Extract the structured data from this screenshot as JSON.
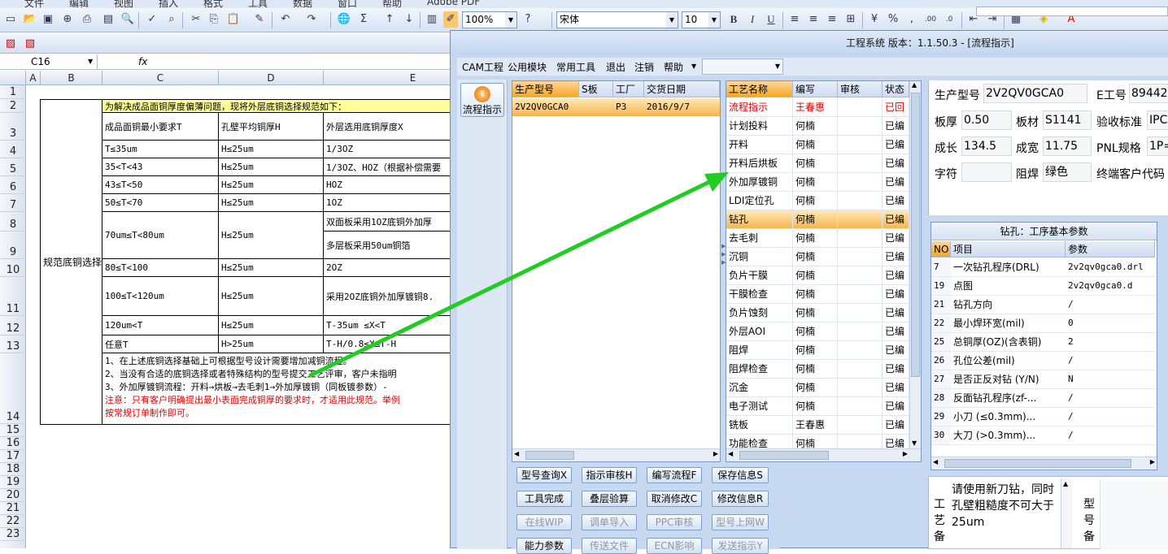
{
  "excel": {
    "menu_fragments": [
      "文件",
      "编辑",
      "视图",
      "插入",
      "格式",
      "工具",
      "数据",
      "窗口",
      "帮助",
      "Adobe PDF"
    ],
    "zoom": "100%",
    "font_name": "宋体",
    "font_size": "10",
    "bold": "B",
    "italic": "I",
    "underline": "U",
    "name_box": "C16",
    "fx": "fx",
    "columns": [
      "A",
      "B",
      "C",
      "D",
      "E"
    ],
    "rows": [
      "1",
      "2",
      "3",
      "4",
      "5",
      "6",
      "7",
      "8",
      "9",
      "10",
      "11",
      "12",
      "13",
      "14",
      "15",
      "16",
      "17",
      "18",
      "19",
      "20",
      "21",
      "22",
      "23"
    ],
    "merged_label": "规范底铜选择",
    "banner": "为解决成品面铜厚度偏薄问题，现将外层底铜选择规范如下：",
    "header_row": [
      "成品面铜最小要求T",
      "孔壁平均铜厚H",
      "外层选用底铜厚度X"
    ],
    "table_rows": [
      [
        "T≤35um",
        "H≤25um",
        "1/3OZ"
      ],
      [
        "35<T<43",
        "H≤25um",
        "1/3OZ、HOZ（根据补偿需要"
      ],
      [
        "43≤T<50",
        "H≤25um",
        "HOZ"
      ],
      [
        "50≤T<70",
        "H≤25um",
        "1OZ"
      ],
      [
        "70um≤T<80um",
        "H≤25um",
        "双面板采用1OZ底铜外加厚"
      ],
      [
        "",
        "",
        "多层板采用50um铜箔"
      ],
      [
        "80≤T<100",
        "H≤25um",
        "2OZ"
      ],
      [
        "100≤T<120um",
        "H≤25um",
        "采用2OZ底铜外加厚镀铜8."
      ],
      [
        "120um<T",
        "H≤25um",
        "T-35um ≤X<T"
      ],
      [
        "任意T",
        "H>25um",
        "T-H/0.8≤X≤T-H"
      ]
    ],
    "notes": [
      "1、在上述底铜选择基础上可根据型号设计需要增加减铜流程。",
      "2、当没有合适的底铜选择或者特殊结构的型号提交工艺评审，客户未指明",
      "3、外加厚镀铜流程：开料→烘板→去毛刺1→外加厚镀铜（同板镀参数）-",
      "注意：只有客户明确提出最小表面完成铜厚的要求时，才适用此规范。举例",
      "按常规订单制作即可。"
    ]
  },
  "window": {
    "title": "工程系统  版本：1.1.50.3 - [流程指示]",
    "menu": [
      "CAM工程",
      "公用模块",
      "常用工具",
      "退出",
      "注销",
      "帮助"
    ],
    "flow_button": "流程指示",
    "orders": {
      "headers": [
        "生产型号",
        "S板",
        "工厂",
        "交货日期"
      ],
      "rows": [
        [
          "2V2QV0GCA0",
          "",
          "P3",
          "2016/9/7"
        ]
      ]
    },
    "processes": {
      "headers": [
        "工艺名称",
        "编写",
        "审核",
        "状态"
      ],
      "rows": [
        [
          "流程指示",
          "王春惠",
          "",
          "已回"
        ],
        [
          "计划投料",
          "何楠",
          "",
          "已编"
        ],
        [
          "开料",
          "何楠",
          "",
          "已编"
        ],
        [
          "开料后烘板",
          "何楠",
          "",
          "已编"
        ],
        [
          "外加厚镀铜",
          "何楠",
          "",
          "已编"
        ],
        [
          "LDI定位孔",
          "何楠",
          "",
          "已编"
        ],
        [
          "钻孔",
          "何楠",
          "",
          "已编"
        ],
        [
          "去毛刺",
          "何楠",
          "",
          "已编"
        ],
        [
          "沉铜",
          "何楠",
          "",
          "已编"
        ],
        [
          "负片干膜",
          "何楠",
          "",
          "已编"
        ],
        [
          "干膜检查",
          "何楠",
          "",
          "已编"
        ],
        [
          "负片蚀刻",
          "何楠",
          "",
          "已编"
        ],
        [
          "外层AOI",
          "何楠",
          "",
          "已编"
        ],
        [
          "阻焊",
          "何楠",
          "",
          "已编"
        ],
        [
          "阻焊检查",
          "何楠",
          "",
          "已编"
        ],
        [
          "沉金",
          "何楠",
          "",
          "已编"
        ],
        [
          "电子测试",
          "何楠",
          "",
          "已编"
        ],
        [
          "铣板",
          "王春惠",
          "",
          "已编"
        ],
        [
          "功能检查",
          "何楠",
          "",
          "已编"
        ]
      ]
    },
    "buttons": [
      [
        "型号查询X",
        "指示审核H",
        "编写流程F",
        "保存信息S"
      ],
      [
        "工具完成",
        "叠层验算",
        "取消修改C",
        "修改信息R"
      ],
      [
        "在线WIP",
        "调单导入",
        "PPC审核",
        "型号上网W"
      ],
      [
        "能力参数",
        "传送文件",
        "ECN影响",
        "发送指示Y"
      ]
    ],
    "info": {
      "model_label": "生产型号",
      "model": "2V2QV0GCA0",
      "e_label": "E工号",
      "e_value": "894429",
      "thick_label": "板厚",
      "thick": "0.50",
      "mat_label": "板材",
      "mat": "S1141",
      "std_label": "验收标准",
      "std": "IPC-",
      "len_label": "成长",
      "len": "134.5",
      "wid_label": "成宽",
      "wid": "11.75",
      "pnl_label": "PNL规格",
      "pnl": "1P=",
      "char_label": "字符",
      "char": "",
      "mask_label": "阻焊",
      "mask": "绿色",
      "end_label": "终端客户代码"
    },
    "params": {
      "title": "钻孔：工序基本参数",
      "headers": [
        "NO",
        "项目",
        "参数"
      ],
      "rows": [
        [
          "7",
          "一次钻孔程序(DRL)",
          "2v2qv0gca0.drl"
        ],
        [
          "19",
          "点图",
          "2v2qv0gca0.d"
        ],
        [
          "21",
          "钻孔方向",
          "/"
        ],
        [
          "22",
          "最小焊环宽(mil)",
          "0"
        ],
        [
          "25",
          "总铜厚(OZ)(含表铜)",
          "2"
        ],
        [
          "26",
          "孔位公差(mil)",
          "/"
        ],
        [
          "27",
          "是否正反对钻 (Y/N)",
          "N"
        ],
        [
          "28",
          "反面钻孔程序(zf-...",
          "/"
        ],
        [
          "29",
          "小刀 (≤0.3mm)...",
          "/"
        ],
        [
          "30",
          "大刀 (>0.3mm)...",
          "/"
        ]
      ]
    },
    "remark": {
      "label": "工艺备",
      "text": "请使用新刀钻，同时孔壁粗糙度不可大于25um",
      "label2": "型号备"
    }
  },
  "colors": {
    "accent_orange": "#f5a623",
    "arrow_green": "#22cc22",
    "red_text": "#e00000",
    "banner_yellow": "#ffff99"
  }
}
